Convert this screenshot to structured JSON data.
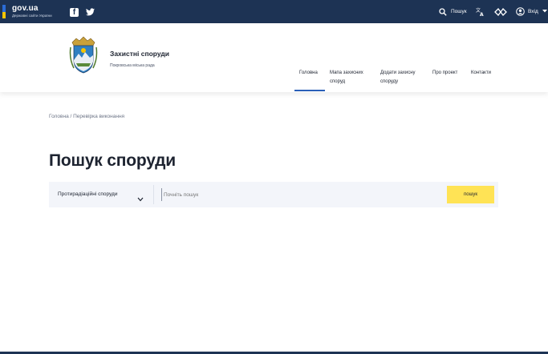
{
  "govbar": {
    "logo": "gov.ua",
    "logo_sub": "Державні сайти України",
    "search_label": "Пошук",
    "login_label": "Вхід",
    "icons": [
      "facebook-icon",
      "twitter-icon",
      "search-icon",
      "translate-icon",
      "accessibility-icon",
      "user-icon",
      "chevron-down-icon"
    ]
  },
  "header": {
    "title": "Захистні споруди",
    "subtitle": "Покровська міська рада",
    "nav": [
      {
        "label": "Головна",
        "active": true
      },
      {
        "label": "Мапа захисних споруд",
        "active": false
      },
      {
        "label": "Додати захисну споруду",
        "active": false
      },
      {
        "label": "Про проект",
        "active": false
      },
      {
        "label": "Контакти",
        "active": false
      }
    ]
  },
  "breadcrumb": "Головна / Перевірка виконання",
  "page_title": "Пошук споруди",
  "search": {
    "category": "Протирадіаційні споруди",
    "placeholder": "Почніть пошук",
    "button": "пошук"
  },
  "colors": {
    "govbar_bg": "#1d3354",
    "accent": "#2a5fb8",
    "button": "#ffe355",
    "searchbar_bg": "#f3f5fa"
  }
}
